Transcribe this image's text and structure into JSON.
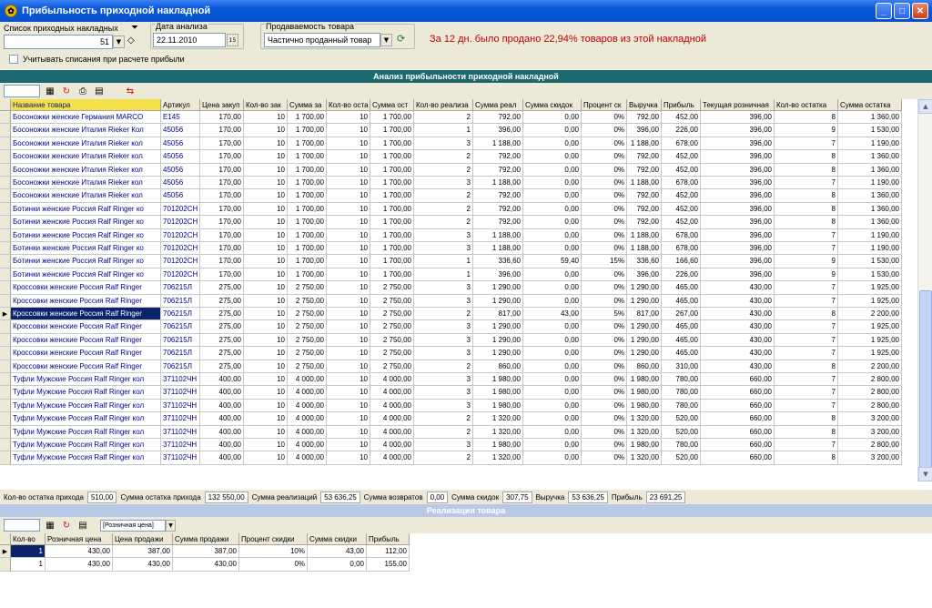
{
  "window": {
    "title": "Прибыльность приходной накладной",
    "buttons": [
      "_",
      "□",
      "✕"
    ]
  },
  "filters": {
    "invoice_list_label": "Список приходных накладных",
    "invoice_value": "51",
    "date_label": "Дата анализа",
    "date_value": "22.11.2010",
    "date_btn": "15",
    "sell_label": "Продаваемость товара",
    "sell_value": "Частично проданный товар",
    "info": "За 12 дн. было продано 22,94% товаров из этой накладной",
    "writeoff_label": "Учитывать списания при расчете прибыли"
  },
  "main_band": "Анализ прибыльности приходной накладной",
  "main_columns": [
    "Название товара",
    "Артикул",
    "Цена закуп",
    "Кол-во зак",
    "Сумма за",
    "Кол-во оста",
    "Сумма ост",
    "Кол-во реализа",
    "Сумма реал",
    "Сумма скидок",
    "Процент ск",
    "Выручка",
    "Прибыль",
    "Текущая розничная",
    "Кол-во остатка",
    "Сумма остатка"
  ],
  "main_rows": [
    [
      "Босоножки женские Германия MARCO",
      "E145",
      "170,00",
      "10",
      "1 700,00",
      "10",
      "1 700,00",
      "2",
      "792,00",
      "0,00",
      "0%",
      "792,00",
      "452,00",
      "396,00",
      "8",
      "1 360,00"
    ],
    [
      "Босоножки женские Италия Rieker Кол",
      "45056",
      "170,00",
      "10",
      "1 700,00",
      "10",
      "1 700,00",
      "1",
      "396,00",
      "0,00",
      "0%",
      "396,00",
      "226,00",
      "396,00",
      "9",
      "1 530,00"
    ],
    [
      "Босоножки женские Италия Rieker кол",
      "45056",
      "170,00",
      "10",
      "1 700,00",
      "10",
      "1 700,00",
      "3",
      "1 188,00",
      "0,00",
      "0%",
      "1 188,00",
      "678,00",
      "396,00",
      "7",
      "1 190,00"
    ],
    [
      "Босоножки женские Италия Rieker кол",
      "45056",
      "170,00",
      "10",
      "1 700,00",
      "10",
      "1 700,00",
      "2",
      "792,00",
      "0,00",
      "0%",
      "792,00",
      "452,00",
      "396,00",
      "8",
      "1 360,00"
    ],
    [
      "Босоножки женские Италия Rieker кол",
      "45056",
      "170,00",
      "10",
      "1 700,00",
      "10",
      "1 700,00",
      "2",
      "792,00",
      "0,00",
      "0%",
      "792,00",
      "452,00",
      "396,00",
      "8",
      "1 360,00"
    ],
    [
      "Босоножки женские Италия Rieker кол",
      "45056",
      "170,00",
      "10",
      "1 700,00",
      "10",
      "1 700,00",
      "3",
      "1 188,00",
      "0,00",
      "0%",
      "1 188,00",
      "678,00",
      "396,00",
      "7",
      "1 190,00"
    ],
    [
      "Босоножки женские Италия Rieker кол",
      "45056",
      "170,00",
      "10",
      "1 700,00",
      "10",
      "1 700,00",
      "2",
      "792,00",
      "0,00",
      "0%",
      "792,00",
      "452,00",
      "396,00",
      "8",
      "1 360,00"
    ],
    [
      "Ботинки женские Россия Ralf Ringer ко",
      "701202CH",
      "170,00",
      "10",
      "1 700,00",
      "10",
      "1 700,00",
      "2",
      "792,00",
      "0,00",
      "0%",
      "792,00",
      "452,00",
      "396,00",
      "8",
      "1 360,00"
    ],
    [
      "Ботинки женские Россия Ralf Ringer ко",
      "701202CH",
      "170,00",
      "10",
      "1 700,00",
      "10",
      "1 700,00",
      "2",
      "792,00",
      "0,00",
      "0%",
      "792,00",
      "452,00",
      "396,00",
      "8",
      "1 360,00"
    ],
    [
      "Ботинки женские Россия Ralf Ringer ко",
      "701202CH",
      "170,00",
      "10",
      "1 700,00",
      "10",
      "1 700,00",
      "3",
      "1 188,00",
      "0,00",
      "0%",
      "1 188,00",
      "678,00",
      "396,00",
      "7",
      "1 190,00"
    ],
    [
      "Ботинки женские Россия Ralf Ringer ко",
      "701202CH",
      "170,00",
      "10",
      "1 700,00",
      "10",
      "1 700,00",
      "3",
      "1 188,00",
      "0,00",
      "0%",
      "1 188,00",
      "678,00",
      "396,00",
      "7",
      "1 190,00"
    ],
    [
      "Ботинки женские Россия Ralf Ringer ко",
      "701202CH",
      "170,00",
      "10",
      "1 700,00",
      "10",
      "1 700,00",
      "1",
      "336,60",
      "59,40",
      "15%",
      "336,60",
      "166,60",
      "396,00",
      "9",
      "1 530,00"
    ],
    [
      "Ботинки женские Россия Ralf Ringer ко",
      "701202CH",
      "170,00",
      "10",
      "1 700,00",
      "10",
      "1 700,00",
      "1",
      "396,00",
      "0,00",
      "0%",
      "396,00",
      "226,00",
      "396,00",
      "9",
      "1 530,00"
    ],
    [
      "Кроссовки женские Россия Ralf Ringer",
      "706215Л",
      "275,00",
      "10",
      "2 750,00",
      "10",
      "2 750,00",
      "3",
      "1 290,00",
      "0,00",
      "0%",
      "1 290,00",
      "465,00",
      "430,00",
      "7",
      "1 925,00"
    ],
    [
      "Кроссовки женские Россия Ralf Ringer",
      "706215Л",
      "275,00",
      "10",
      "2 750,00",
      "10",
      "2 750,00",
      "3",
      "1 290,00",
      "0,00",
      "0%",
      "1 290,00",
      "465,00",
      "430,00",
      "7",
      "1 925,00"
    ],
    [
      "Кроссовки женские Россия Ralf Ringer",
      "706215Л",
      "275,00",
      "10",
      "2 750,00",
      "10",
      "2 750,00",
      "2",
      "817,00",
      "43,00",
      "5%",
      "817,00",
      "267,00",
      "430,00",
      "8",
      "2 200,00"
    ],
    [
      "Кроссовки женские Россия Ralf Ringer",
      "706215Л",
      "275,00",
      "10",
      "2 750,00",
      "10",
      "2 750,00",
      "3",
      "1 290,00",
      "0,00",
      "0%",
      "1 290,00",
      "465,00",
      "430,00",
      "7",
      "1 925,00"
    ],
    [
      "Кроссовки женские Россия Ralf Ringer",
      "706215Л",
      "275,00",
      "10",
      "2 750,00",
      "10",
      "2 750,00",
      "3",
      "1 290,00",
      "0,00",
      "0%",
      "1 290,00",
      "465,00",
      "430,00",
      "7",
      "1 925,00"
    ],
    [
      "Кроссовки женские Россия Ralf Ringer",
      "706215Л",
      "275,00",
      "10",
      "2 750,00",
      "10",
      "2 750,00",
      "3",
      "1 290,00",
      "0,00",
      "0%",
      "1 290,00",
      "465,00",
      "430,00",
      "7",
      "1 925,00"
    ],
    [
      "Кроссовки женские Россия Ralf Ringer",
      "706215Л",
      "275,00",
      "10",
      "2 750,00",
      "10",
      "2 750,00",
      "2",
      "860,00",
      "0,00",
      "0%",
      "860,00",
      "310,00",
      "430,00",
      "8",
      "2 200,00"
    ],
    [
      "Туфли Мужские Россия Ralf Ringer кол",
      "371102ЧН",
      "400,00",
      "10",
      "4 000,00",
      "10",
      "4 000,00",
      "3",
      "1 980,00",
      "0,00",
      "0%",
      "1 980,00",
      "780,00",
      "660,00",
      "7",
      "2 800,00"
    ],
    [
      "Туфли Мужские Россия Ralf Ringer кол",
      "371102ЧН",
      "400,00",
      "10",
      "4 000,00",
      "10",
      "4 000,00",
      "3",
      "1 980,00",
      "0,00",
      "0%",
      "1 980,00",
      "780,00",
      "660,00",
      "7",
      "2 800,00"
    ],
    [
      "Туфли Мужские Россия Ralf Ringer кол",
      "371102ЧН",
      "400,00",
      "10",
      "4 000,00",
      "10",
      "4 000,00",
      "3",
      "1 980,00",
      "0,00",
      "0%",
      "1 980,00",
      "780,00",
      "660,00",
      "7",
      "2 800,00"
    ],
    [
      "Туфли Мужские Россия Ralf Ringer кол",
      "371102ЧН",
      "400,00",
      "10",
      "4 000,00",
      "10",
      "4 000,00",
      "2",
      "1 320,00",
      "0,00",
      "0%",
      "1 320,00",
      "520,00",
      "660,00",
      "8",
      "3 200,00"
    ],
    [
      "Туфли Мужские Россия Ralf Ringer кол",
      "371102ЧН",
      "400,00",
      "10",
      "4 000,00",
      "10",
      "4 000,00",
      "2",
      "1 320,00",
      "0,00",
      "0%",
      "1 320,00",
      "520,00",
      "660,00",
      "8",
      "3 200,00"
    ],
    [
      "Туфли Мужские Россия Ralf Ringer кол",
      "371102ЧН",
      "400,00",
      "10",
      "4 000,00",
      "10",
      "4 000,00",
      "3",
      "1 980,00",
      "0,00",
      "0%",
      "1 980,00",
      "780,00",
      "660,00",
      "7",
      "2 800,00"
    ],
    [
      "Туфли Мужские Россия Ralf Ringer кол",
      "371102ЧН",
      "400,00",
      "10",
      "4 000,00",
      "10",
      "4 000,00",
      "2",
      "1 320,00",
      "0,00",
      "0%",
      "1 320,00",
      "520,00",
      "660,00",
      "8",
      "3 200,00"
    ]
  ],
  "selected_row": 15,
  "totals": [
    {
      "label": "Кол-во остатка прихода",
      "value": "510,00"
    },
    {
      "label": "Сумма остатка прихода",
      "value": "132 550,00"
    },
    {
      "label": "Сумма реализаций",
      "value": "53 636,25"
    },
    {
      "label": "Сумма возвратов",
      "value": "0,00"
    },
    {
      "label": "Сумма скидок",
      "value": "307,75"
    },
    {
      "label": "Выручка",
      "value": "53 636,25"
    },
    {
      "label": "Прибыль",
      "value": "23 691,25"
    }
  ],
  "sales_band": "Реализации товара",
  "sales_filter": "[Розничная цена]",
  "sales_columns": [
    "Кол-во",
    "Розничная цена",
    "Цена продажи",
    "Сумма продажи",
    "Процент скидки",
    "Сумма скидки",
    "Прибыль"
  ],
  "sales_rows": [
    [
      "1",
      "430,00",
      "387,00",
      "387,00",
      "10%",
      "43,00",
      "112,00"
    ],
    [
      "1",
      "430,00",
      "430,00",
      "430,00",
      "0%",
      "0,00",
      "155,00"
    ]
  ],
  "colors": {
    "title": "#0651d0",
    "band": "#1c6a70",
    "selected": "#0a246a",
    "info": "#c00000"
  }
}
